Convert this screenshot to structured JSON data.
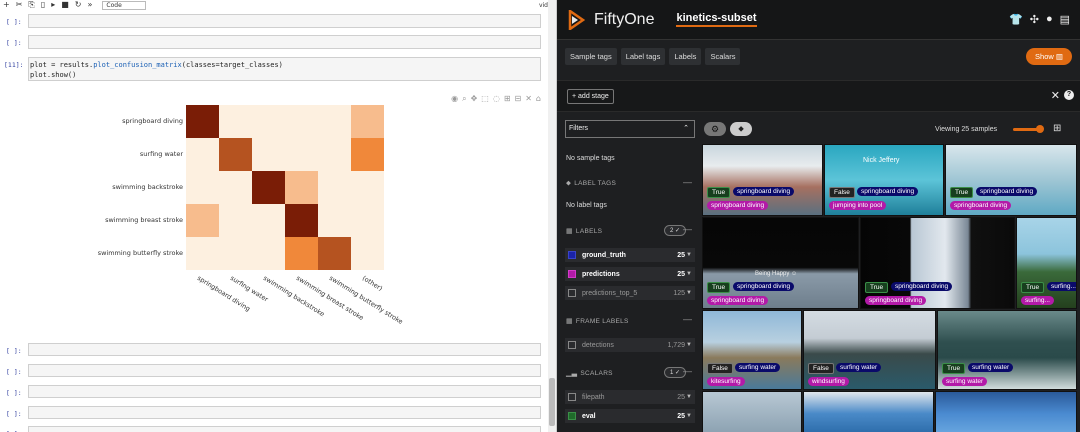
{
  "notebook": {
    "toolbar": {
      "cell_type": "Code",
      "right_label": "vid"
    },
    "empty_prompt": "[ ]:",
    "code_cell": {
      "prompt": "[11]:",
      "line1_a": "plot = results.",
      "line1_fn": "plot_confusion_matrix",
      "line1_b": "(classes=target_classes)",
      "line2": "plot.show()"
    },
    "chart_data": {
      "type": "heatmap",
      "rows": [
        "springboard diving",
        "surfing water",
        "swimming backstroke",
        "swimming breast stroke",
        "swimming butterfly stroke"
      ],
      "columns": [
        "springboard diving",
        "surfing water",
        "swimming backstroke",
        "swimming breast stroke",
        "swimming butterfly stroke",
        "(other)"
      ],
      "values": [
        [
          8,
          0,
          0,
          0,
          0,
          2
        ],
        [
          0,
          6,
          0,
          0,
          0,
          4
        ],
        [
          0,
          0,
          8,
          2,
          0,
          0
        ],
        [
          2,
          0,
          0,
          8,
          0,
          0
        ],
        [
          0,
          0,
          0,
          4,
          6,
          0
        ]
      ],
      "max": 8,
      "colors": {
        "low": "#fdf0e0",
        "mid": "#f0883a",
        "high": "#7a1d06"
      }
    }
  },
  "fiftyone": {
    "app_title": "FiftyOne",
    "dataset": "kinetics-subset",
    "tabs": [
      "Sample tags",
      "Label tags",
      "Labels",
      "Scalars"
    ],
    "show_button": "Show",
    "add_stage": "+ add stage",
    "filters_label": "Filters",
    "no_sample_tags": "No sample tags",
    "label_tags_header": "LABEL TAGS",
    "no_label_tags": "No label tags",
    "labels_header": "LABELS",
    "labels_pill": "2 ✓",
    "labels": [
      {
        "name": "ground_truth",
        "count": "25",
        "checked": true,
        "color": "#1a23a8"
      },
      {
        "name": "predictions",
        "count": "25",
        "checked": true,
        "color": "#b31aa8"
      },
      {
        "name": "predictions_top_5",
        "count": "125",
        "checked": false,
        "color": ""
      }
    ],
    "frame_labels_header": "FRAME LABELS",
    "frame_labels": [
      {
        "name": "detections",
        "count": "1,729"
      }
    ],
    "scalars_header": "SCALARS",
    "scalars_pill": "1 ✓",
    "scalars": [
      {
        "name": "filepath",
        "count": "25",
        "checked": false,
        "color": ""
      },
      {
        "name": "eval",
        "count": "25",
        "checked": true,
        "color": "#1f6b2a"
      }
    ],
    "viewing_text": "Viewing 25 samples",
    "tiles": [
      {
        "bool": "True",
        "gt": "springboard diving",
        "pred": "springboard diving"
      },
      {
        "bool": "False",
        "gt": "springboard diving",
        "pred": "jumping into pool",
        "overlay": "Nick Jeffery"
      },
      {
        "bool": "True",
        "gt": "springboard diving",
        "pred": "springboard diving"
      },
      {
        "bool": "True",
        "gt": "springboard diving",
        "pred": "springboard diving",
        "overlay": "Being Happy ☺"
      },
      {
        "bool": "True",
        "gt": "springboard diving",
        "pred": "springboard diving"
      },
      {
        "bool": "True",
        "gt": "surfing...",
        "pred": "surfing..."
      },
      {
        "bool": "False",
        "gt": "surfing water",
        "pred": "kitesurfing"
      },
      {
        "bool": "False",
        "gt": "surfing water",
        "pred": "windsurfing"
      },
      {
        "bool": "True",
        "gt": "surfing water",
        "pred": "surfing water"
      }
    ]
  }
}
